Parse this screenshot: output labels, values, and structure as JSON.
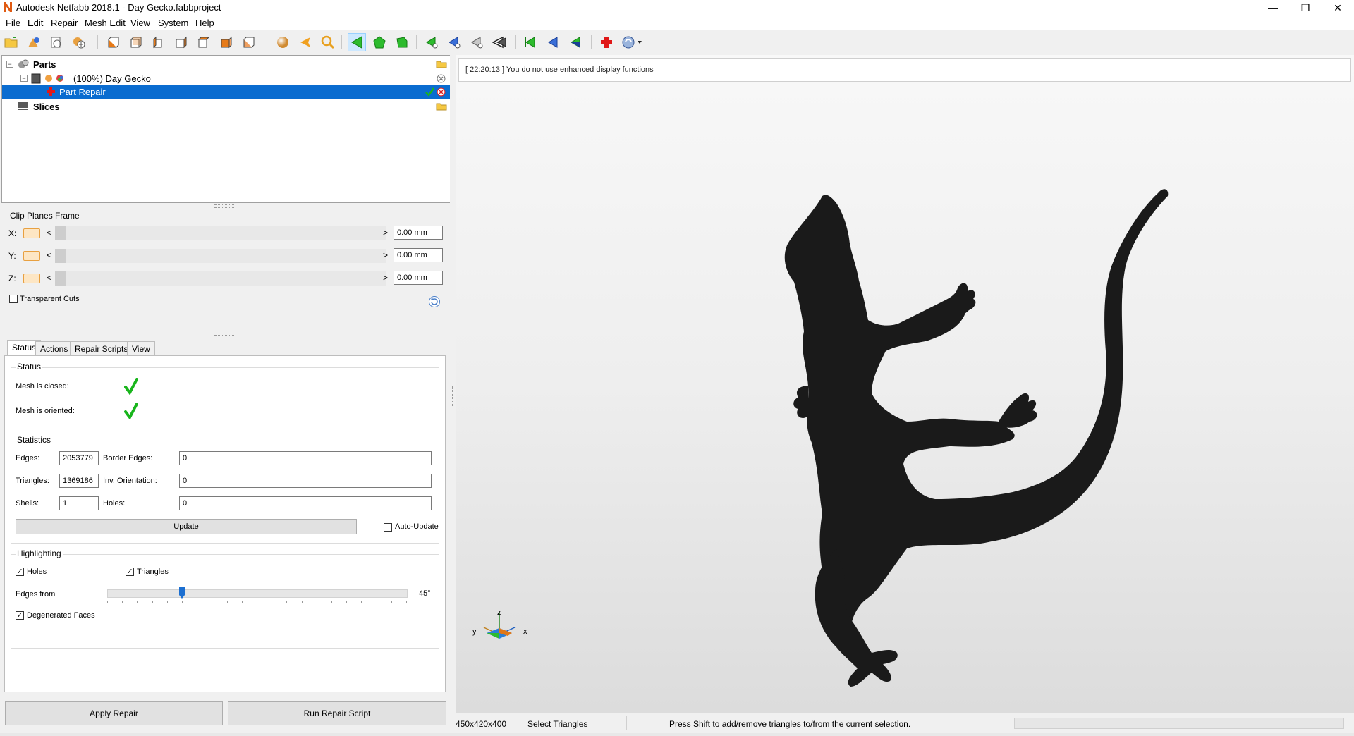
{
  "window": {
    "title": "Autodesk Netfabb 2018.1 - Day Gecko.fabbproject",
    "minimize_glyph": "—",
    "maximize_glyph": "❐",
    "close_glyph": "✕"
  },
  "menu": {
    "items": [
      "File",
      "Edit",
      "Repair",
      "Mesh Edit",
      "View",
      "System",
      "Help"
    ]
  },
  "toolbar": {
    "icons": [
      "open-folder-icon",
      "add-part-icon",
      "new-project-icon",
      "add-icon",
      "view-front-icon",
      "view-back-icon",
      "view-left-icon",
      "view-right-icon",
      "view-top-icon",
      "view-bottom-icon",
      "view-iso-icon",
      "sphere-icon",
      "arrow-left-orange-icon",
      "zoom-icon",
      "select-triangles-icon",
      "select-surface-icon",
      "select-shell-icon",
      "select-mode-1-icon",
      "select-mode-2-icon",
      "select-mode-3-icon",
      "select-mode-4-icon",
      "select-all-icon",
      "deselect-icon",
      "invert-selection-icon",
      "repair-cross-icon",
      "settings-dropdown-icon"
    ]
  },
  "tree": {
    "parts_label": "Parts",
    "part_label": "(100%) Day Gecko",
    "repair_label": "Part Repair",
    "slices_label": "Slices"
  },
  "clip_planes": {
    "title": "Clip Planes Frame",
    "rows": [
      {
        "axis": "X:",
        "value": "0.00 mm"
      },
      {
        "axis": "Y:",
        "value": "0.00 mm"
      },
      {
        "axis": "Z:",
        "value": "0.00 mm"
      }
    ],
    "left_arrow": "<",
    "right_arrow": ">",
    "transparent_cuts_label": "Transparent Cuts",
    "transparent_cuts_checked": false
  },
  "tabs": [
    "Status",
    "Actions",
    "Repair Scripts",
    "View"
  ],
  "status_group": {
    "title": "Status",
    "mesh_closed_label": "Mesh is closed:",
    "mesh_oriented_label": "Mesh is oriented:"
  },
  "statistics": {
    "title": "Statistics",
    "edges_label": "Edges:",
    "edges_value": "2053779",
    "border_edges_label": "Border Edges:",
    "border_edges_value": "0",
    "triangles_label": "Triangles:",
    "triangles_value": "1369186",
    "inv_orientation_label": "Inv. Orientation:",
    "inv_orientation_value": "0",
    "shells_label": "Shells:",
    "shells_value": "1",
    "holes_label": "Holes:",
    "holes_value": "0",
    "update_label": "Update",
    "auto_update_label": "Auto-Update",
    "auto_update_checked": false
  },
  "highlighting": {
    "title": "Highlighting",
    "holes_label": "Holes",
    "holes_checked": true,
    "triangles_label": "Triangles",
    "triangles_checked": true,
    "edges_from_label": "Edges from",
    "edges_from_value": "45°",
    "slider_fraction": 0.25,
    "degenerated_faces_label": "Degenerated Faces",
    "degenerated_faces_checked": true
  },
  "buttons": {
    "apply_repair": "Apply Repair",
    "run_repair_script": "Run Repair Script"
  },
  "log": {
    "message": "[ 22:20:13 ] You do not use enhanced display functions"
  },
  "axis_gizmo": {
    "x": "x",
    "y": "y",
    "z": "z"
  },
  "statusbar": {
    "dimensions": "450x420x400",
    "mode": "Select Triangles",
    "hint": "Press Shift to add/remove triangles to/from the current selection."
  },
  "colors": {
    "selection": "#0a6cd0",
    "check_green": "#19b51c",
    "model": "#1a1a1a",
    "accent_orange": "#e8a040"
  }
}
